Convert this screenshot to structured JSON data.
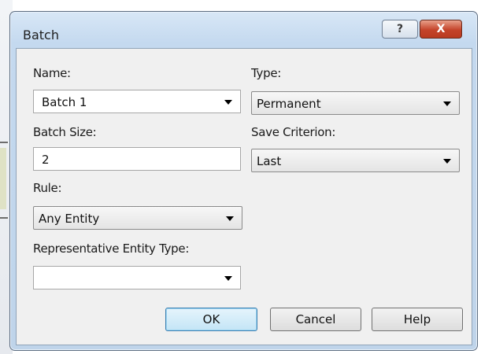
{
  "window": {
    "title": "Batch"
  },
  "titlebar": {
    "help_glyph": "?",
    "close_glyph": "X"
  },
  "form": {
    "name": {
      "label": "Name:",
      "value": "Batch 1"
    },
    "type": {
      "label": "Type:",
      "value": "Permanent"
    },
    "batch_size": {
      "label": "Batch Size:",
      "value": "2"
    },
    "save_criterion": {
      "label": "Save Criterion:",
      "value": "Last"
    },
    "rule": {
      "label": "Rule:",
      "value": "Any Entity"
    },
    "rep_entity_type": {
      "label": "Representative Entity Type:",
      "value": ""
    }
  },
  "buttons": {
    "ok": "OK",
    "cancel": "Cancel",
    "help": "Help"
  }
}
